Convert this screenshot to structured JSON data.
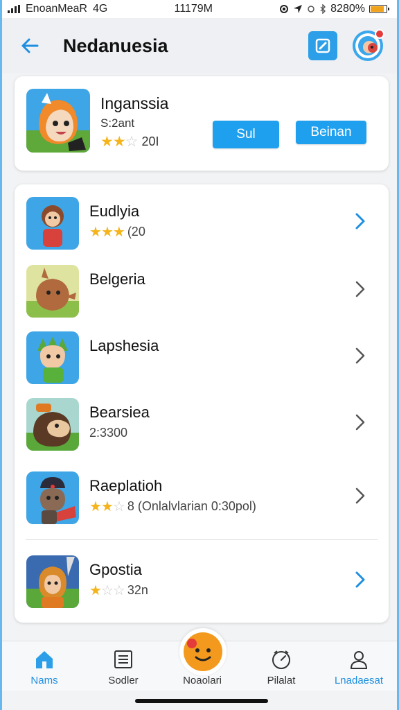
{
  "status_bar": {
    "carrier": "EnoanMeaR",
    "network": "4G",
    "time": "11179M",
    "battery_text": "8280%",
    "battery_level": 0.85
  },
  "header": {
    "title": "Nedanuesia",
    "back_icon": "arrow-left-icon",
    "edit_icon": "edit-icon",
    "profile_icon": "profile-icon"
  },
  "featured": {
    "name": "Inganssia",
    "subtitle": "S:2ant",
    "rating": 2,
    "rating_max": 3,
    "count": "20I",
    "button1": "Sul",
    "button2": "Beinan"
  },
  "apps": [
    {
      "name": "Eudlyia",
      "rating": 3,
      "rating_max": 3,
      "sub_text": "(20",
      "has_stars": true
    },
    {
      "name": "Belgeria",
      "sub_text": "",
      "has_stars": false
    },
    {
      "name": "Lapshesia",
      "sub_text": "",
      "has_stars": false
    },
    {
      "name": "Bearsiea",
      "sub_text": "2:3300",
      "has_stars": false
    },
    {
      "name": "Raeplatioh",
      "rating": 2,
      "rating_max": 3,
      "sub_text": "8 (Onlalvlarian 0:30pol)",
      "has_stars": true
    },
    {
      "name": "Gpostia",
      "rating": 1,
      "rating_max": 3,
      "sub_text": "32n",
      "has_stars": true
    }
  ],
  "bottom_nav": {
    "items": [
      {
        "label": "Nams",
        "icon": "home-icon"
      },
      {
        "label": "Sodler",
        "icon": "list-icon"
      },
      {
        "label": "Noaolari",
        "icon": "smiley-icon"
      },
      {
        "label": "Pilalat",
        "icon": "clock-icon"
      },
      {
        "label": "Lnadaesat",
        "icon": "user-icon"
      }
    ]
  },
  "colors": {
    "accent": "#1fa0ee",
    "star": "#f4b41a"
  }
}
